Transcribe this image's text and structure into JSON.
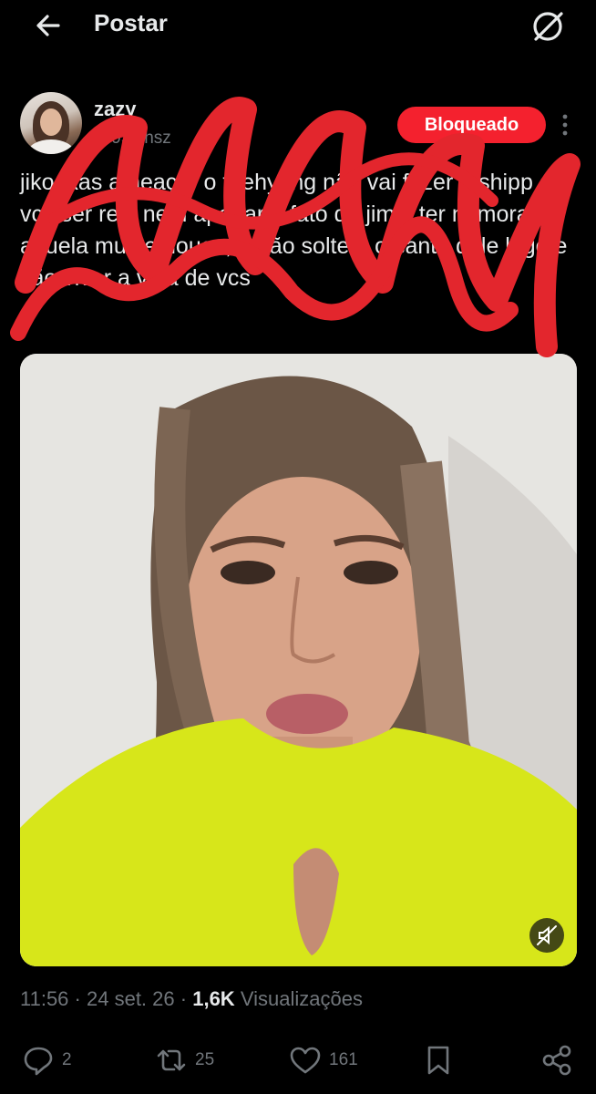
{
  "header": {
    "title": "Postar"
  },
  "author": {
    "name": "zazy",
    "handle": "@95kthsz"
  },
  "badge": {
    "label": "Bloqueado"
  },
  "tweet": {
    "text": "jikookas ameaçar o taehyung não vai fazer o shipp de vcs ser real nem apagar o fato do jimin ter namorado aquela mulher louca, então soltem o santo dele logo e vão viver a vida de vcs"
  },
  "meta": {
    "time": "11:56",
    "date": "24 set. 26",
    "views_count": "1,6K",
    "views_label": "Visualizações",
    "separator": "·"
  },
  "actions": {
    "replies": "2",
    "reposts": "25",
    "likes": "161"
  },
  "colors": {
    "badge": "#f4212e",
    "scribble": "#e3262d",
    "secondary_text": "#71767b"
  },
  "icons": [
    "back-arrow-icon",
    "grok-icon",
    "more-vertical-icon",
    "mute-icon",
    "reply-icon",
    "repost-icon",
    "like-icon",
    "bookmark-icon",
    "share-icon"
  ]
}
